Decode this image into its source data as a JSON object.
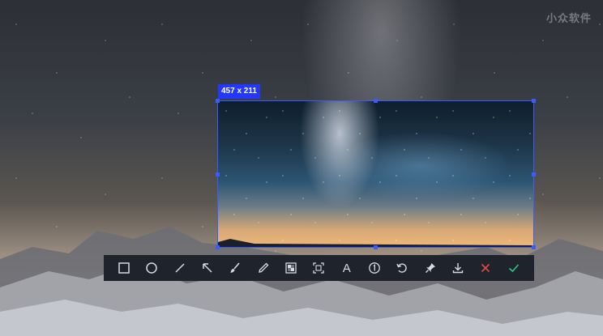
{
  "watermark": {
    "text": "小众软件"
  },
  "selection": {
    "size_label": "457 x 211"
  },
  "toolbar": {
    "text_tool_label": "A",
    "colors": {
      "icon": "#d7dbe3",
      "cancel": "#e24a4a",
      "confirm": "#2fc07d"
    },
    "tools": [
      {
        "name": "rectangle-icon"
      },
      {
        "name": "ellipse-icon"
      },
      {
        "name": "line-icon"
      },
      {
        "name": "arrow-icon"
      },
      {
        "name": "brush-icon"
      },
      {
        "name": "pencil-icon"
      },
      {
        "name": "mosaic-icon"
      },
      {
        "name": "ocr-scan-icon"
      },
      {
        "name": "text-icon"
      },
      {
        "name": "number-marker-icon"
      },
      {
        "name": "undo-icon"
      },
      {
        "name": "pin-icon"
      },
      {
        "name": "download-icon"
      },
      {
        "name": "cancel-icon"
      },
      {
        "name": "confirm-icon"
      }
    ]
  }
}
